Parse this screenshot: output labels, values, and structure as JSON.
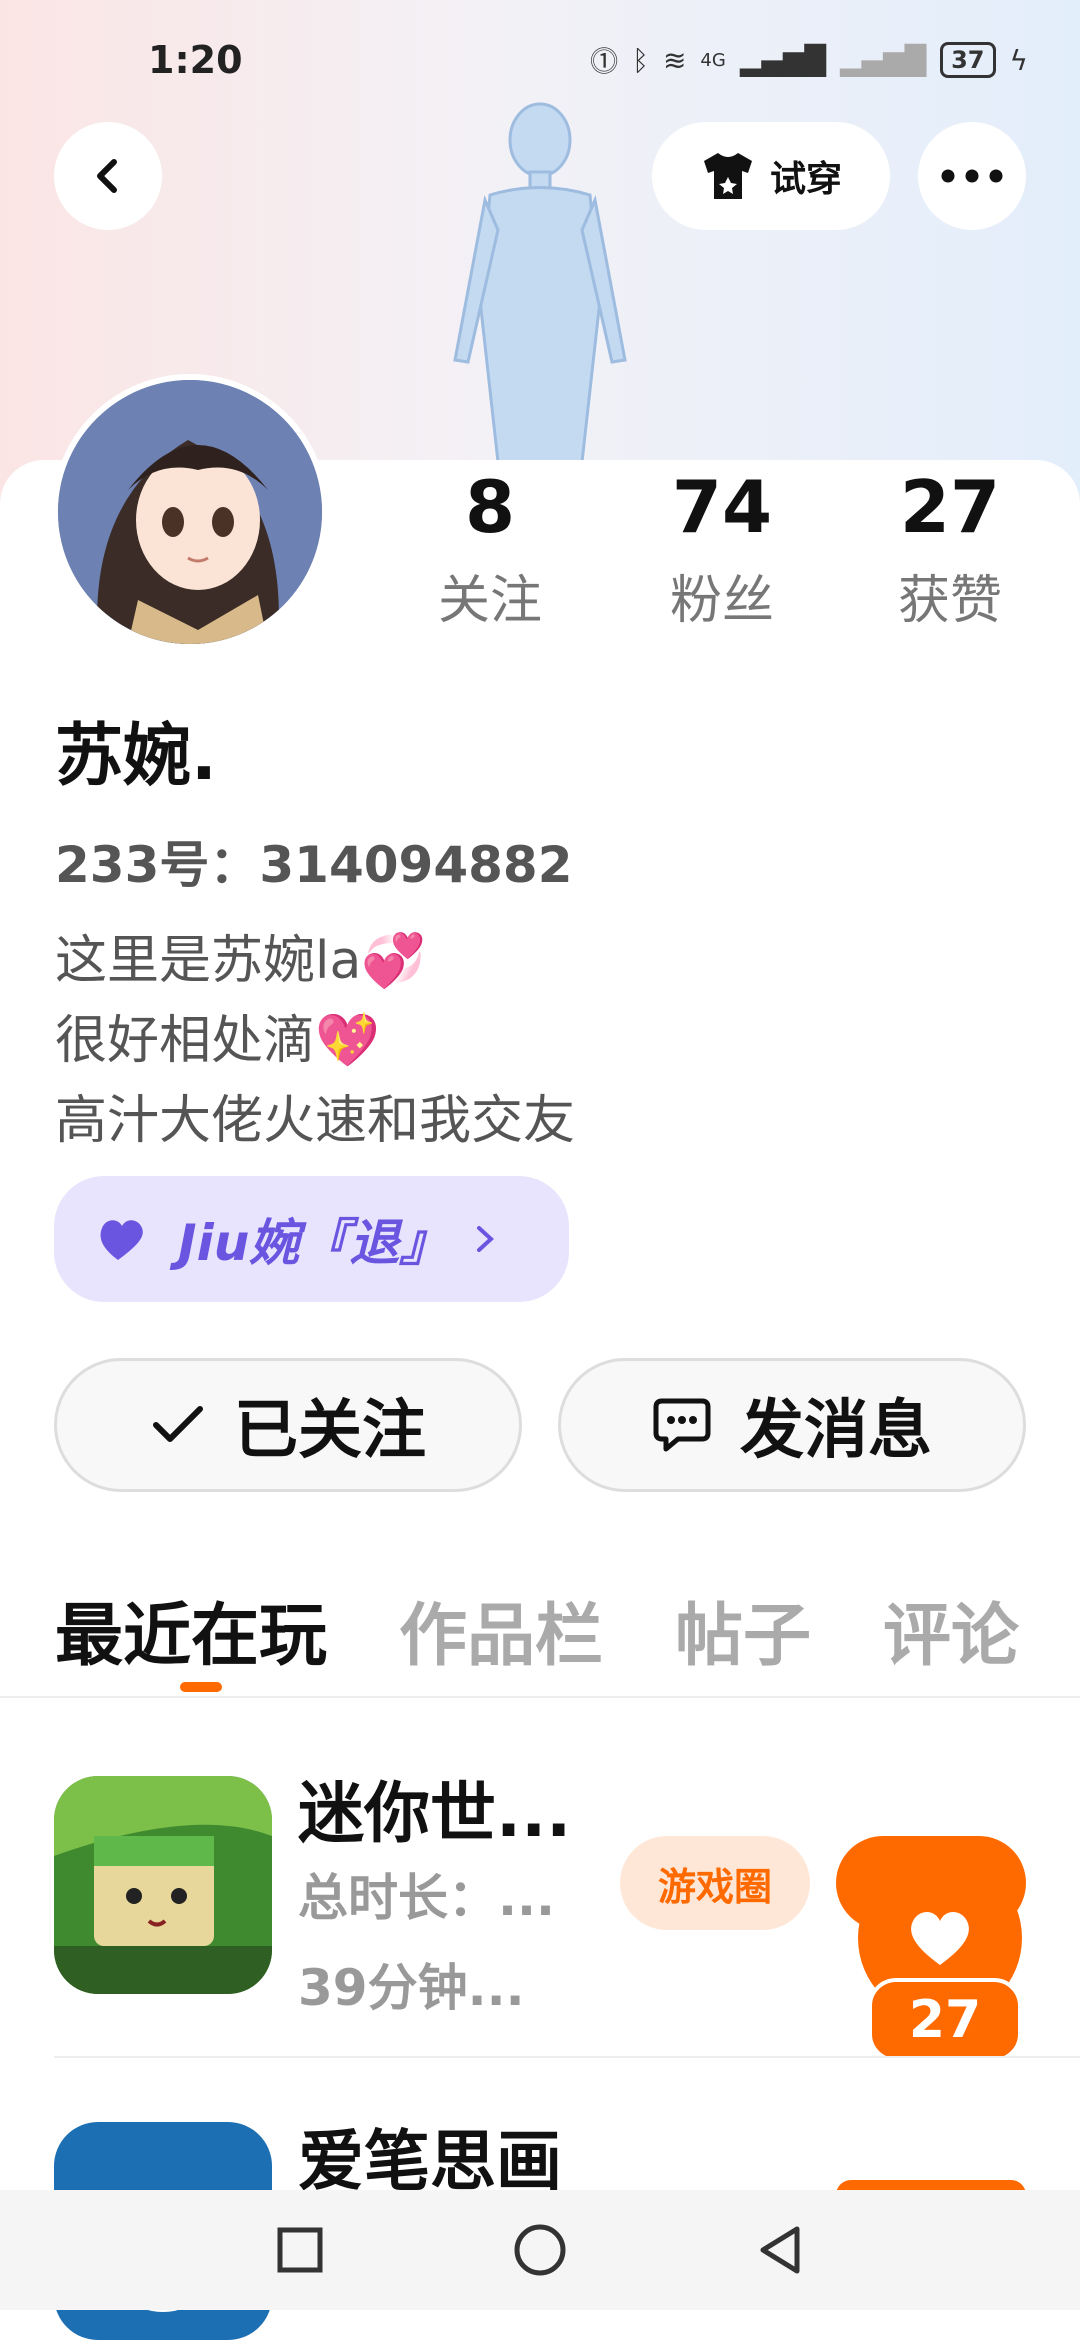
{
  "status_bar": {
    "time": "1:20",
    "network": "4G",
    "battery": "37"
  },
  "header": {
    "try_on_label": "试穿"
  },
  "stats": [
    {
      "number": "8",
      "label": "关注"
    },
    {
      "number": "74",
      "label": "粉丝"
    },
    {
      "number": "27",
      "label": "获赞"
    }
  ],
  "profile": {
    "name": "苏婉.",
    "id_text": "233号：314094882",
    "bio": [
      "这里是苏婉la",
      "很好相处滴",
      "高汁大佬火速和我交友"
    ]
  },
  "fan_badge": {
    "text": "Jiu婉『退』"
  },
  "actions": {
    "followed_label": "已关注",
    "message_label": "发消息"
  },
  "tabs": [
    {
      "label": "最近在玩",
      "active": true
    },
    {
      "label": "作品栏",
      "active": false
    },
    {
      "label": "帖子",
      "active": false
    },
    {
      "label": "评论",
      "active": false
    }
  ],
  "games": [
    {
      "name": "迷你世...",
      "meta1": "总时长：...",
      "meta2": "39分钟...",
      "circle_label": "游戏圈"
    },
    {
      "name": "爱笔思画"
    }
  ],
  "floating_like": {
    "count": "27"
  },
  "colors": {
    "accent": "#ff6a00",
    "fan_badge": "#6a55e0"
  }
}
